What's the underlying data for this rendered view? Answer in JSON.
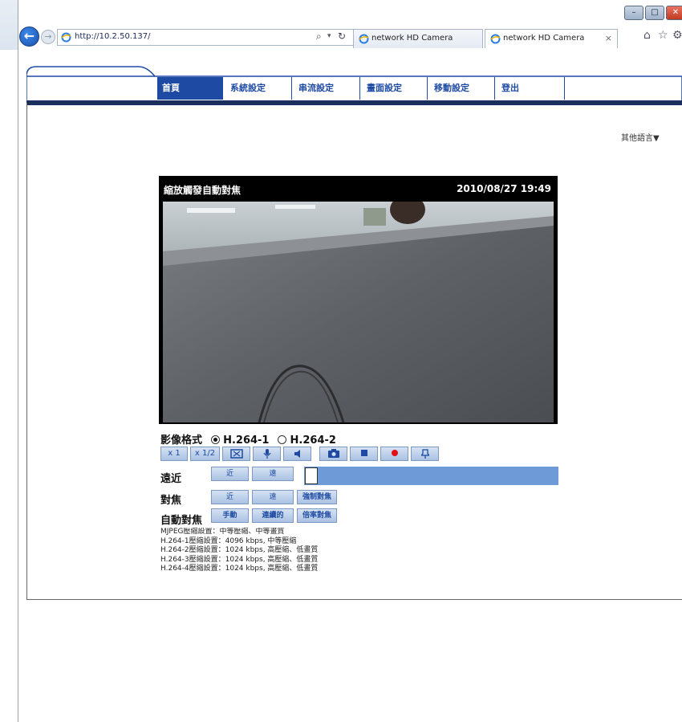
{
  "browser": {
    "address": "http://10.2.50.137/",
    "tabs": [
      {
        "label": "network HD Camera"
      },
      {
        "label": "network HD Camera"
      }
    ],
    "tab_close": "×",
    "accent": "#1e4aa3"
  },
  "nav": {
    "items": [
      "首頁",
      "系統設定",
      "串流設定",
      "畫面設定",
      "移動設定",
      "登出"
    ],
    "language_link": "其他語言▼"
  },
  "video": {
    "title": "縮放觸發自動對焦",
    "timestamp": "2010/08/27 19:49"
  },
  "format": {
    "label": "影像格式",
    "options": [
      {
        "label": "H.264-1",
        "selected": true
      },
      {
        "label": "H.264-2",
        "selected": false
      }
    ]
  },
  "toolbar": {
    "scale_1": "x 1",
    "scale_half": "x 1/2",
    "icons": [
      "fullscreen-icon",
      "microphone-icon",
      "speaker-icon",
      "snapshot-icon",
      "stop-icon",
      "record-icon",
      "alarm-icon"
    ]
  },
  "zoom": {
    "label": "遠近",
    "near": "近",
    "far": "遠",
    "level": 0
  },
  "focus": {
    "label": "對焦",
    "near": "近",
    "far": "遠",
    "force": "強制對焦"
  },
  "autofocus": {
    "label": "自動對焦",
    "manual": "手動",
    "continuous": "連續的",
    "zoom_trigger": "倍率對焦"
  },
  "status": [
    "MJPEG壓縮設置：中等壓縮、中等畫質",
    "H.264-1壓縮設置：4096 kbps, 中等壓縮",
    "H.264-2壓縮設置：1024 kbps, 高壓縮、低畫質",
    "H.264-3壓縮設置：1024 kbps, 高壓縮、低畫質",
    "H.264-4壓縮設置：1024 kbps, 高壓縮、低畫質"
  ]
}
